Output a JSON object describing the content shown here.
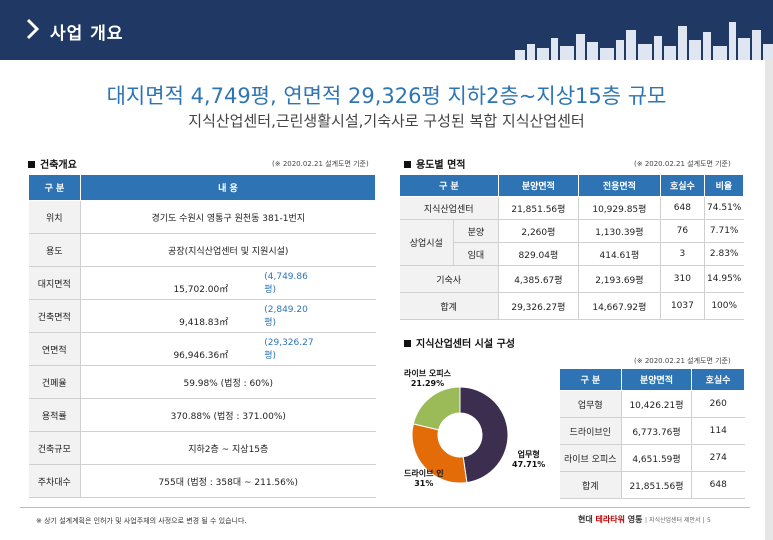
{
  "header": {
    "title": "사업 개요"
  },
  "headline": "대지면적 4,749평, 연면적 29,326평 지하2층~지상15층 규모",
  "subline": "지식산업센터,근린생활시설,기숙사로 구성된 복합 지식산업센터",
  "overview": {
    "title": "건축개요",
    "note": "(※ 2020.02.21 설계도면 기준)",
    "col1": "구 분",
    "col2": "내 용",
    "rows": [
      {
        "label": "위치",
        "value": "경기도 수원시 영통구 원천동 381-1번지",
        "sub": ""
      },
      {
        "label": "용도",
        "value": "공장(지식산업센터 및 지원시설)",
        "sub": ""
      },
      {
        "label": "대지면적",
        "value": "15,702.00㎡",
        "sub": "(4,749.86평)"
      },
      {
        "label": "건축면적",
        "value": "9,418.83㎡",
        "sub": "(2,849.20평)"
      },
      {
        "label": "연면적",
        "value": "96,946.36㎡",
        "sub": "(29,326.27평)"
      },
      {
        "label": "건폐율",
        "value": "59.98% (법정 : 60%)",
        "sub": ""
      },
      {
        "label": "용적률",
        "value": "370.88% (법정 : 371.00%)",
        "sub": ""
      },
      {
        "label": "건축규모",
        "value": "지하2층 ~ 지상15층",
        "sub": ""
      },
      {
        "label": "주차대수",
        "value": "755대 (법정 : 358대 ~ 211.56%)",
        "sub": ""
      }
    ]
  },
  "usage": {
    "title": "용도별 면적",
    "note": "(※ 2020.02.21 설계도면 기준)",
    "headers": [
      "구 분",
      "분양면적",
      "전용면적",
      "호실수",
      "비율"
    ],
    "rows": [
      {
        "label": "지식산업센터",
        "sub": "",
        "a": "21,851.56평",
        "b": "10,929.85평",
        "c": "648",
        "d": "74.51%"
      },
      {
        "label": "상업시설",
        "sub": "분양",
        "a": "2,260평",
        "b": "1,130.39평",
        "c": "76",
        "d": "7.71%"
      },
      {
        "label": "",
        "sub": "임대",
        "a": "829.04평",
        "b": "414.61평",
        "c": "3",
        "d": "2.83%"
      },
      {
        "label": "기숙사",
        "sub": "",
        "a": "4,385.67평",
        "b": "2,193.69평",
        "c": "310",
        "d": "14.95%"
      },
      {
        "label": "합계",
        "sub": "",
        "a": "29,326.27평",
        "b": "14,667.92평",
        "c": "1037",
        "d": "100%"
      }
    ]
  },
  "facility": {
    "title": "지식산업센터 시설 구성",
    "note": "(※ 2020.02.21 설계도면 기준)",
    "headers": [
      "구 분",
      "분양면적",
      "호실수"
    ],
    "rows": [
      {
        "label": "업무형",
        "a": "10,426.21평",
        "b": "260"
      },
      {
        "label": "드라이브인",
        "a": "6,773.76평",
        "b": "114"
      },
      {
        "label": "라이브 오피스",
        "a": "4,651.59평",
        "b": "274"
      },
      {
        "label": "합계",
        "a": "21,851.56평",
        "b": "648"
      }
    ]
  },
  "chart_data": {
    "type": "pie",
    "donut": true,
    "slices": [
      {
        "name": "업무형",
        "value": 47.71,
        "label": "47.71%",
        "color": "#3b2e4f"
      },
      {
        "name": "드라이브 인",
        "value": 31,
        "label": "31%",
        "color": "#e36c09"
      },
      {
        "name": "라이브 오피스",
        "value": 21.29,
        "label": "21.29%",
        "color": "#9bbb59"
      }
    ]
  },
  "footer": {
    "footnote": "※ 상기 설계계획은 인허가 및 사업주체의 사정으로 변경 될 수 있습니다.",
    "brand_prefix": "현대 ",
    "brand_red": "테라타워",
    "brand_suffix": " 영통",
    "brand_sub": "| 지식산업센터 제안서 |",
    "page": "5"
  },
  "colors": {
    "header_bg": "#1f3864",
    "table_head": "#2e74b5",
    "accent_text": "#2e75b6"
  }
}
